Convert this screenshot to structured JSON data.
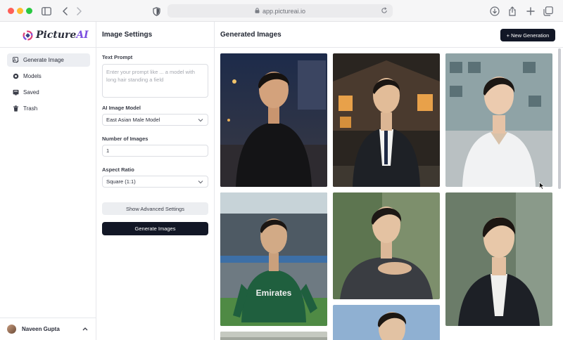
{
  "browser": {
    "url": "app.pictureai.io",
    "icons": [
      "sidebar-toggle-icon",
      "back-icon",
      "forward-icon",
      "shield-icon",
      "lock-icon",
      "reload-icon",
      "download-icon",
      "share-icon",
      "new-tab-icon",
      "tabs-overview-icon"
    ]
  },
  "brand": {
    "name_prefix": "Picture",
    "name_suffix": "AI",
    "accent": "#7b4fe0"
  },
  "sidebar": {
    "items": [
      {
        "label": "Generate Image",
        "icon": "image-edit-icon",
        "active": true
      },
      {
        "label": "Models",
        "icon": "models-icon",
        "active": false
      },
      {
        "label": "Saved",
        "icon": "saved-icon",
        "active": false
      },
      {
        "label": "Trash",
        "icon": "trash-icon",
        "active": false
      }
    ],
    "user": {
      "name": "Naveen Gupta"
    }
  },
  "settings": {
    "title": "Image Settings",
    "prompt_label": "Text Prompt",
    "prompt_placeholder": "Enter your prompt like ... a model with long hair standing a field",
    "model_label": "AI Image Model",
    "model_value": "East Asian Male Model",
    "count_label": "Number of Images",
    "count_value": "1",
    "ratio_label": "Aspect Ratio",
    "ratio_value": "Square (1:1)",
    "advanced_button": "Show Advanced Settings",
    "generate_button": "Generate Images"
  },
  "gallery": {
    "title": "Generated Images",
    "new_button": "+ New Generation",
    "jersey_text": "Emirates"
  },
  "colors": {
    "primary_dark": "#121726",
    "border": "#e6e7eb"
  }
}
